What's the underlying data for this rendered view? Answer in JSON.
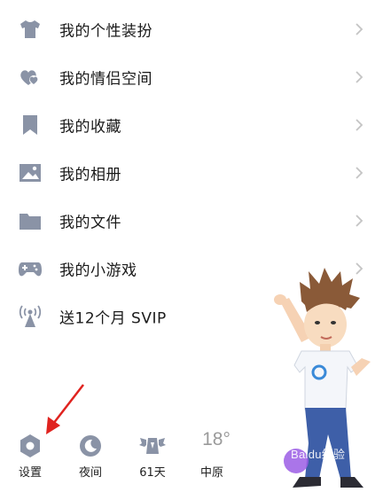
{
  "menu": {
    "items": [
      {
        "label": "我的个性装扮",
        "icon": "shirt-icon"
      },
      {
        "label": "我的情侣空间",
        "icon": "hearts-icon"
      },
      {
        "label": "我的收藏",
        "icon": "bookmark-icon"
      },
      {
        "label": "我的相册",
        "icon": "photo-icon"
      },
      {
        "label": "我的文件",
        "icon": "folder-icon"
      },
      {
        "label": "我的小游戏",
        "icon": "gamepad-icon"
      },
      {
        "label": "送12个月 SVIP",
        "icon": "broadcast-icon"
      }
    ]
  },
  "toolbar": {
    "settings_label": "设置",
    "night_label": "夜间",
    "days_label": "61天",
    "temperature": "18°",
    "city": "中原"
  },
  "watermark": "Baidu经验",
  "colors": {
    "icon": "#8a93a6",
    "chevron": "#c4c4c4",
    "arrow": "#e0231f",
    "text": "#1a1a1a"
  }
}
